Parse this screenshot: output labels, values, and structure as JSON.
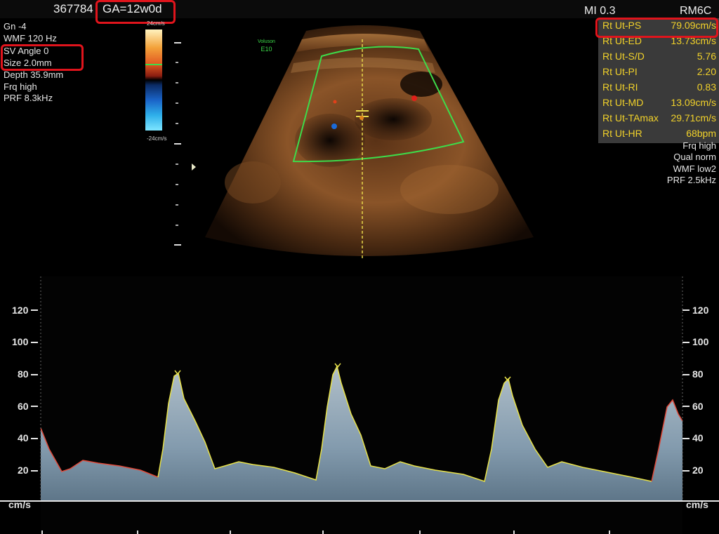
{
  "header": {
    "id_partial": "367784",
    "ga": "GA=12w0d",
    "mi": "MI 0.3",
    "probe": "RM6C"
  },
  "left_params": [
    "Gn -4",
    "WMF 120 Hz",
    "SV Angle 0",
    "Size 2.0mm",
    "Depth 35.9mm",
    "Frq high",
    "PRF 8.3kHz"
  ],
  "color_scale": {
    "top": "24cm/s",
    "bottom": "-24cm/s"
  },
  "device_label": {
    "line1": "Voluson",
    "line2": "E10"
  },
  "measurements": [
    {
      "label": "Rt Ut-PS",
      "value": "79.09cm/s"
    },
    {
      "label": "Rt Ut-ED",
      "value": "13.73cm/s"
    },
    {
      "label": "Rt Ut-S/D",
      "value": "5.76"
    },
    {
      "label": "Rt Ut-PI",
      "value": "2.20"
    },
    {
      "label": "Rt Ut-RI",
      "value": "0.83"
    },
    {
      "label": "Rt Ut-MD",
      "value": "13.09cm/s"
    },
    {
      "label": "Rt Ut-TAmax",
      "value": "29.71cm/s"
    },
    {
      "label": "Rt Ut-HR",
      "value": "68bpm"
    }
  ],
  "right_params": [
    "Frq high",
    "Qual norm",
    "WMF low2",
    "PRF 2.5kHz"
  ],
  "spectral": {
    "ticks": [
      "120",
      "100",
      "80",
      "60",
      "40",
      "20"
    ],
    "unit": "cm/s"
  },
  "colors": {
    "highlight": "#e0141c",
    "measure_text": "#f2d22a",
    "trace": "#e8e24a",
    "gate": "#3ddc4a",
    "spectrum": "#a9c4d8"
  }
}
